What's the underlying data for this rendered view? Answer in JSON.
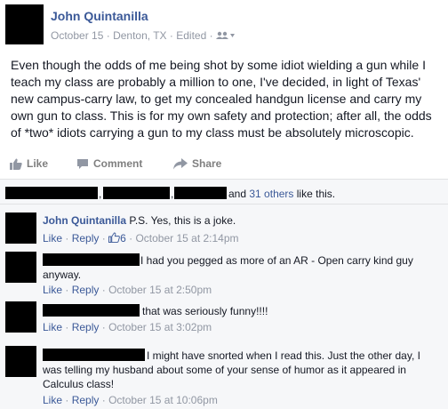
{
  "post": {
    "author": "John Quintanilla",
    "date": "October 15",
    "location": "Denton, TX",
    "edited": "Edited",
    "sep": "·",
    "body": "Even though the odds of me being shot by some idiot wielding a gun while I teach my class are probably a million to one, I've decided, in light of Texas' new campus-carry law, to get my concealed handgun license and carry my own gun to class. This is for my own safety and protection; after all, the odds of *two* idiots carrying a gun to my class must be absolutely microscopic."
  },
  "actions": {
    "like": "Like",
    "comment": "Comment",
    "share": "Share"
  },
  "likes": {
    "sep1": ",",
    "sep2": ",",
    "and": "and",
    "others": "31 others",
    "suffix": "like this."
  },
  "comments": [
    {
      "author": "John Quintanilla",
      "text": "P.S. Yes, this is a joke.",
      "like": "Like",
      "reply": "Reply",
      "sep": "·",
      "like_count": "6",
      "time": "October 15 at 2:14pm"
    },
    {
      "text_line1": "I had you pegged as more of an AR - Open carry kind guy",
      "text_line2": "anyway.",
      "like": "Like",
      "reply": "Reply",
      "sep": "·",
      "time": "October 15 at 2:50pm"
    },
    {
      "text": "that was seriously funny!!!!",
      "like": "Like",
      "reply": "Reply",
      "sep": "·",
      "time": "October 15 at 3:02pm"
    },
    {
      "text_line1": "I might have snorted when I read this. Just the other day, I",
      "text_line2": "was telling my husband about some of your sense of humor as it appeared in",
      "text_line3": "Calculus class!",
      "like": "Like",
      "reply": "Reply",
      "sep": "·",
      "time": "October 15 at 10:06pm"
    }
  ]
}
